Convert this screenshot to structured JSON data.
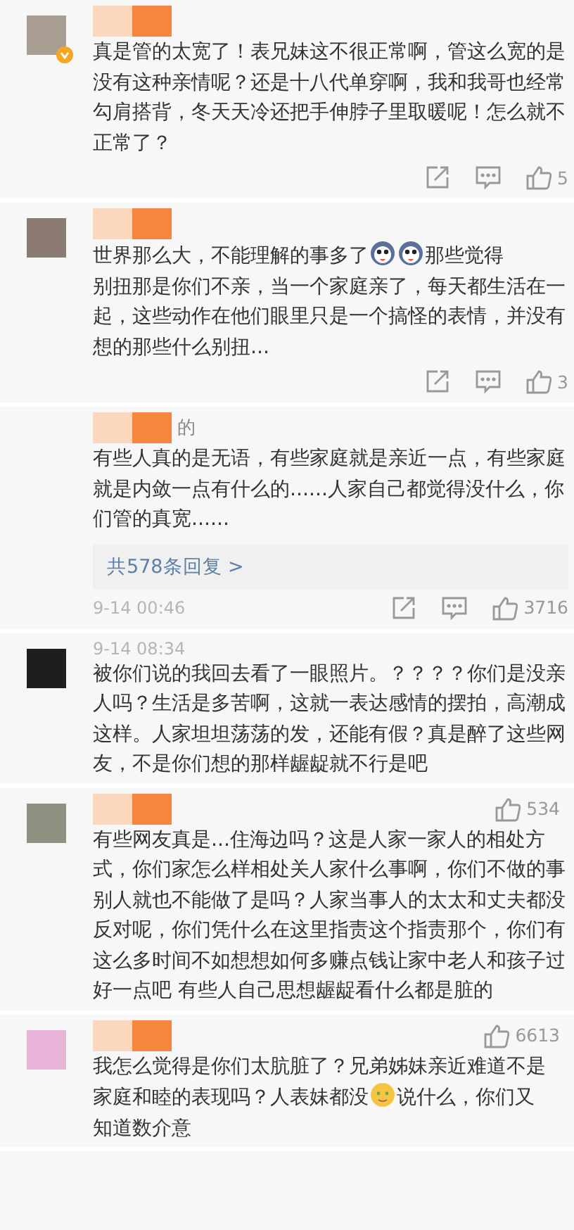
{
  "comments": [
    {
      "avatar": {
        "color": "#a89f92"
      },
      "verified": true,
      "name_blurred": true,
      "text": [
        [
          {
            "kind": "text",
            "text": "真是管的太宽了！表兄妹这不很正常啊，管这么宽的是没有这种亲情呢？还是十八代单穿啊，我和我哥也经常勾肩搭背，冬天天冷还把手伸脖子里取暖呢！怎么就不正常了？"
          }
        ]
      ],
      "footer": {
        "tools": [
          {
            "kind": "share"
          },
          {
            "kind": "comment"
          },
          {
            "kind": "like",
            "count": "5"
          }
        ]
      }
    },
    {
      "avatar": {
        "color": "#8a7a72"
      },
      "verified": false,
      "name_blurred": true,
      "text": [
        [
          {
            "kind": "text",
            "text": "世界那么大，不能理解的事多了"
          },
          {
            "kind": "dog"
          },
          {
            "kind": "dog"
          },
          {
            "kind": "text",
            "text": "那些觉得"
          }
        ],
        [
          {
            "kind": "text",
            "text": "别扭那是你们不亲，当一个家庭亲了，每天都生活在一起，这些动作在他们眼里只是一个搞怪的表情，并没有想的那些什么别扭..."
          }
        ]
      ],
      "footer": {
        "tools": [
          {
            "kind": "share"
          },
          {
            "kind": "comment"
          },
          {
            "kind": "like",
            "count": "3"
          }
        ]
      }
    },
    {
      "name_blurred": true,
      "name_fragment": "的",
      "text": [
        [
          {
            "kind": "text",
            "text": "有些人真的是无语，有些家庭就是亲近一点，有些家庭就是内敛一点有什么的......人家自己都觉得没什么，你们管的真宽......"
          }
        ]
      ],
      "replies": "共578条回复 >",
      "footer": {
        "time": "9-14 00:46",
        "tools": [
          {
            "kind": "share"
          },
          {
            "kind": "comment"
          },
          {
            "kind": "like",
            "count": "3716"
          }
        ]
      }
    },
    {
      "avatar": {
        "color": "#1e1e1e"
      },
      "time": "9-14 08:34",
      "text": [
        [
          {
            "kind": "text",
            "text": "被你们说的我回去看了一眼照片。？？？？你们是没亲人吗？生活是多苦啊，这就一表达感情的摆拍，高潮成这样。人家坦坦荡荡的发，还能有假？真是醉了这些网友，不是你们想的那样龌龊就不行是吧"
          }
        ]
      ]
    },
    {
      "avatar": {
        "color": "#8e9080"
      },
      "name_blurred": true,
      "header_tools": [
        {
          "kind": "like",
          "count": "534"
        }
      ],
      "text": [
        [
          {
            "kind": "text",
            "text": "有些网友真是...住海边吗？这是人家一家人的相处方式，你们家怎么样相处关人家什么事啊，你们不做的事别人就也不能做了是吗？人家当事人的太太和丈夫都没反对呢，你们凭什么在这里指责这个指责那个，你们有这么多时间不如想想如何多赚点钱让家中老人和孩子过好一点吧  有些人自己思想龌龊看什么都是脏的"
          }
        ]
      ]
    },
    {
      "avatar": {
        "color": "#e8b4d8"
      },
      "name_blurred": true,
      "header_tools": [
        {
          "kind": "like",
          "count": "6613"
        }
      ],
      "text": [
        [
          {
            "kind": "text",
            "text": "我怎么觉得是你们太肮脏了？兄弟姊妹亲近难道不是"
          }
        ],
        [
          {
            "kind": "text",
            "text": "家庭和睦的表现吗？人表妹都没"
          },
          {
            "kind": "smile"
          },
          {
            "kind": "text",
            "text": "说什么，你们又"
          }
        ],
        [
          {
            "kind": "text",
            "text": "知道数介意"
          }
        ]
      ]
    }
  ]
}
